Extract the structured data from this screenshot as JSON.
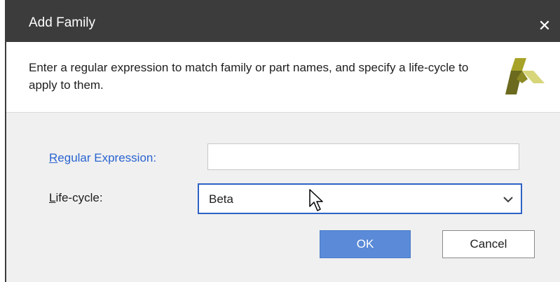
{
  "window": {
    "title": "Add Family",
    "close_glyph": "✕"
  },
  "header": {
    "description": "Enter a regular expression to match family or part names, and specify a life-cycle to apply to them.",
    "logo_icon": "xilinx-logo-icon"
  },
  "form": {
    "regex_label_mnemonic": "R",
    "regex_label_rest": "egular Expression:",
    "regex_value": "",
    "lifecycle_label_mnemonic": "L",
    "lifecycle_label_rest": "ife-cycle:",
    "lifecycle_selected": "Beta"
  },
  "buttons": {
    "ok_label": "OK",
    "cancel_label": "Cancel"
  },
  "colors": {
    "titlebar": "#3c3c3c",
    "accent_blue": "#2d62c5",
    "ok_button": "#5a8ad8",
    "link_label": "#2a64d0",
    "logo_olive": "#a7a328",
    "logo_dark": "#6b6a1e",
    "logo_light": "#d7d67a"
  }
}
